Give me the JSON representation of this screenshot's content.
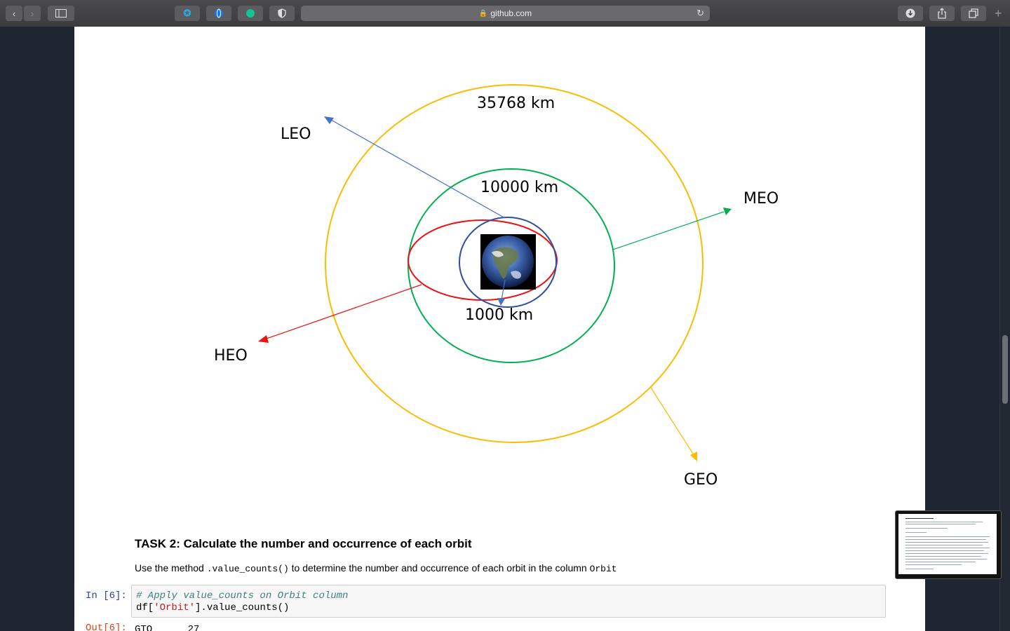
{
  "browser": {
    "url": "github.com"
  },
  "diagram": {
    "label_geo_altitude": "35768 km",
    "label_meo_altitude": "10000 km",
    "label_leo_altitude": "1000 km",
    "label_leo": "LEO",
    "label_meo": "MEO",
    "label_heo": "HEO",
    "label_geo": "GEO",
    "colors": {
      "geo": "#fbbc04",
      "meo": "#00b050",
      "heo": "#ee1111",
      "leo": "#2f4f9f",
      "leo_arrow": "#4472c4"
    }
  },
  "notebook": {
    "task_title": "TASK 2: Calculate the number and occurrence of each orbit",
    "para_before": "Use the method ",
    "para_code1": ".value_counts()",
    "para_middle": " to determine the number and occurrence of each orbit in the column ",
    "para_code2": "Orbit",
    "cell_prompt_in": "In [6]:",
    "cell_comment": "# Apply value_counts on Orbit column",
    "cell_code_prefix": "df[",
    "cell_code_string": "'Orbit'",
    "cell_code_suffix": "].value_counts()",
    "cell_prompt_out": "Out[6]:",
    "output_first_line": "GTO      27"
  }
}
